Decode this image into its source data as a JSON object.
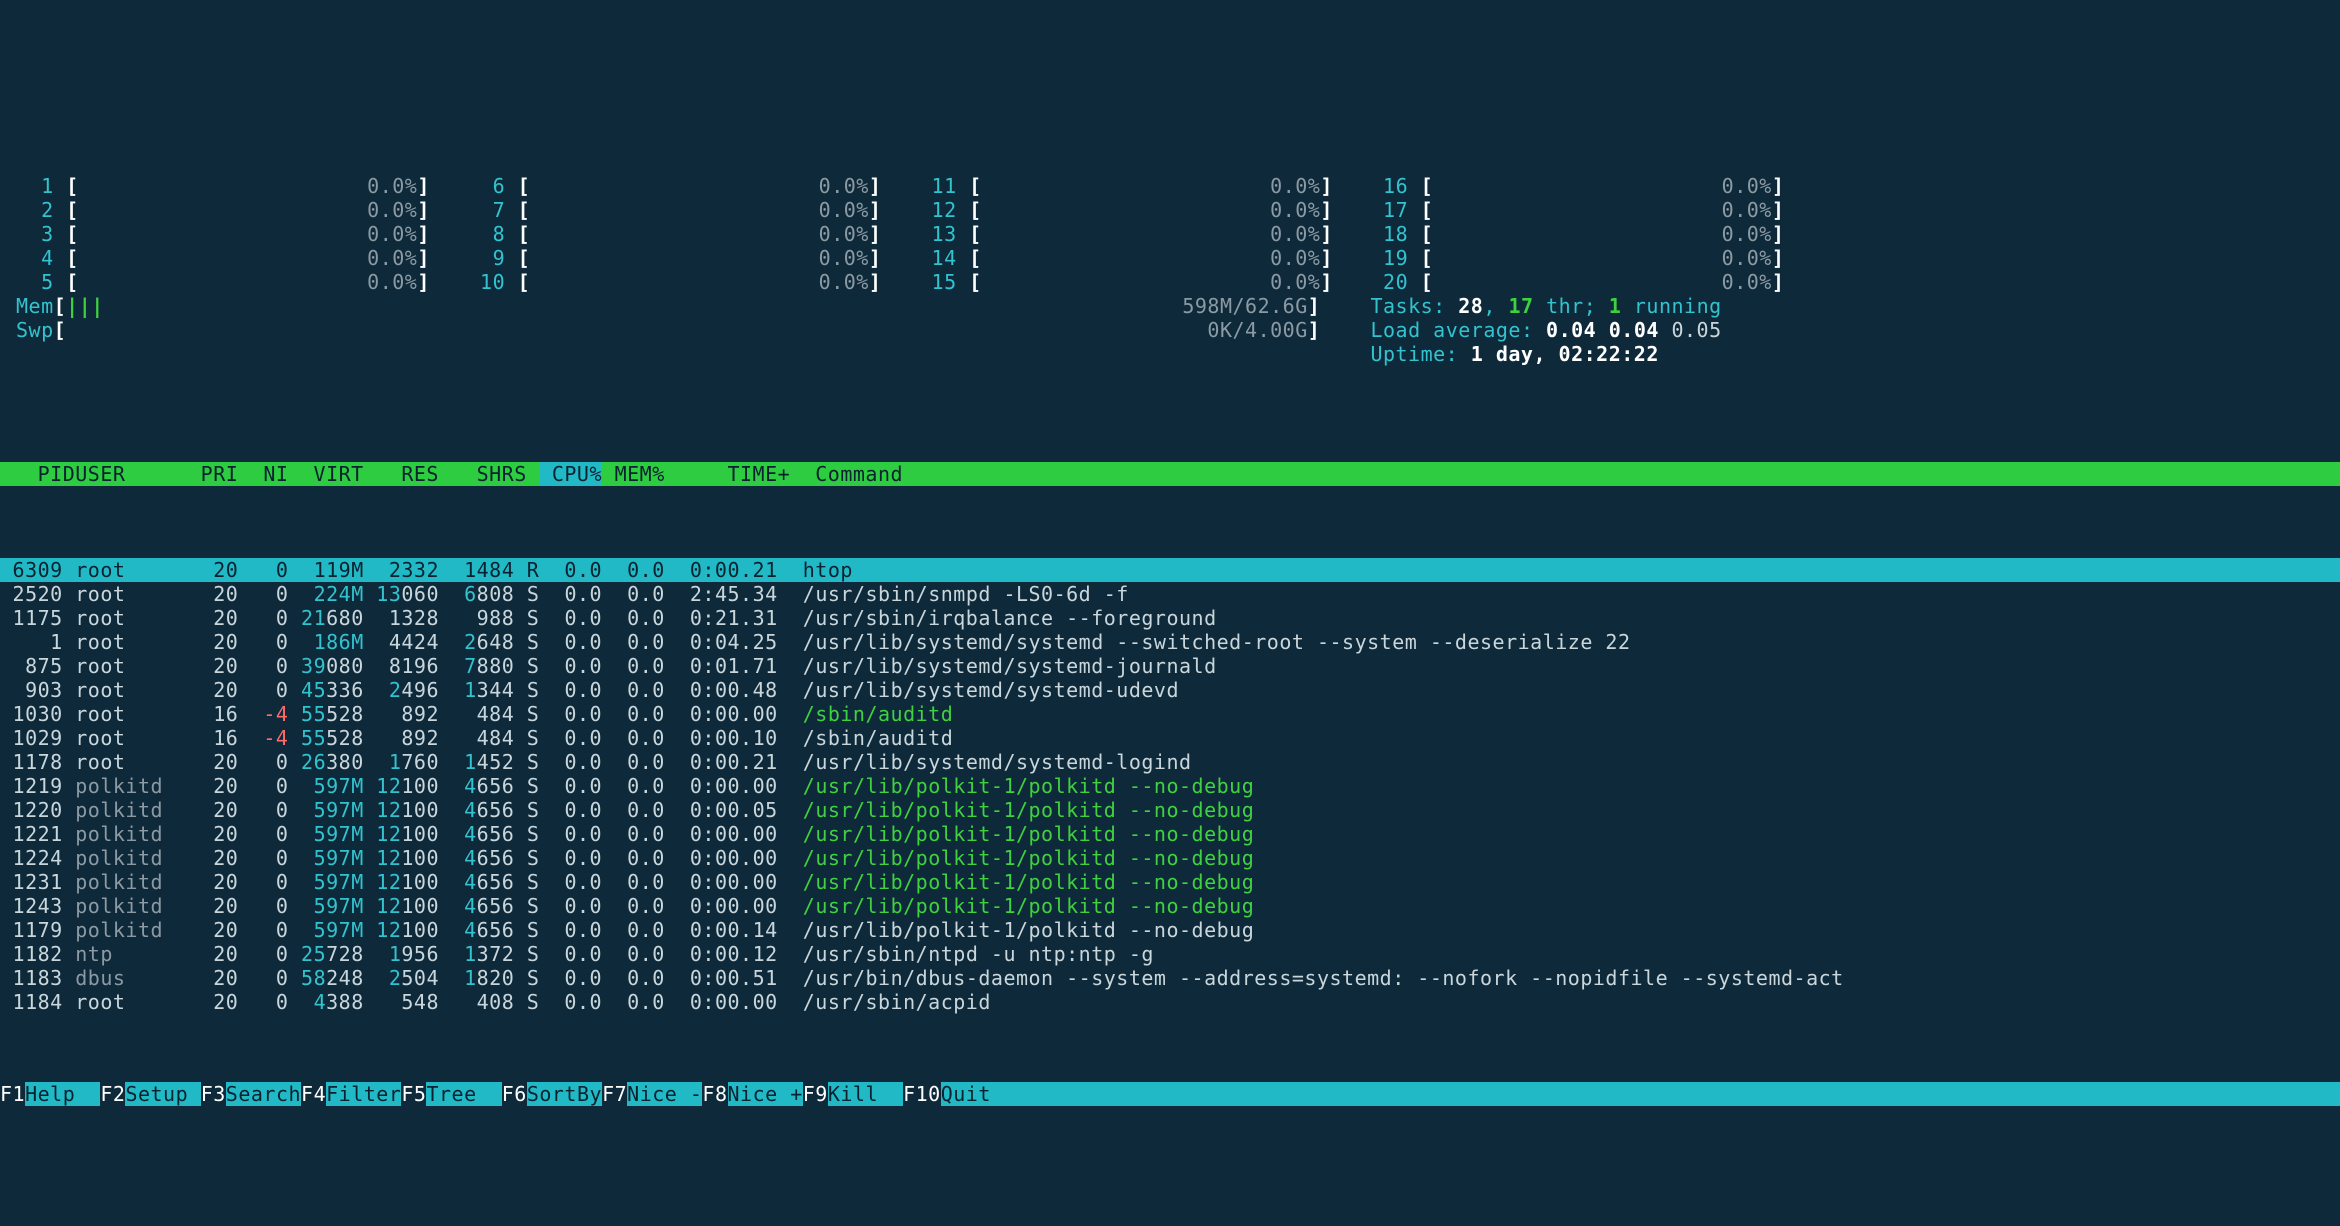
{
  "meters": {
    "cpus": [
      {
        "n": "1",
        "pct": "0.0%"
      },
      {
        "n": "2",
        "pct": "0.0%"
      },
      {
        "n": "3",
        "pct": "0.0%"
      },
      {
        "n": "4",
        "pct": "0.0%"
      },
      {
        "n": "5",
        "pct": "0.0%"
      },
      {
        "n": "6",
        "pct": "0.0%"
      },
      {
        "n": "7",
        "pct": "0.0%"
      },
      {
        "n": "8",
        "pct": "0.0%"
      },
      {
        "n": "9",
        "pct": "0.0%"
      },
      {
        "n": "10",
        "pct": "0.0%"
      },
      {
        "n": "11",
        "pct": "0.0%"
      },
      {
        "n": "12",
        "pct": "0.0%"
      },
      {
        "n": "13",
        "pct": "0.0%"
      },
      {
        "n": "14",
        "pct": "0.0%"
      },
      {
        "n": "15",
        "pct": "0.0%"
      },
      {
        "n": "16",
        "pct": "0.0%"
      },
      {
        "n": "17",
        "pct": "0.0%"
      },
      {
        "n": "18",
        "pct": "0.0%"
      },
      {
        "n": "19",
        "pct": "0.0%"
      },
      {
        "n": "20",
        "pct": "0.0%"
      }
    ],
    "mem": {
      "label": "Mem",
      "bars": "|||",
      "value": "598M/62.6G"
    },
    "swp": {
      "label": "Swp",
      "bars": "",
      "value": "0K/4.00G"
    },
    "tasks": {
      "label": "Tasks: ",
      "total": "28",
      "thr_sep": ", ",
      "thr": "17",
      "thr_word": " thr; ",
      "run": "1",
      "run_word": " running"
    },
    "load": {
      "label": "Load average: ",
      "v1": "0.04",
      "v2": "0.04",
      "v3": "0.05"
    },
    "uptime": {
      "label": "Uptime: ",
      "value": "1 day, 02:22:22"
    }
  },
  "columns": [
    "PID",
    "USER",
    "PRI",
    "NI",
    "VIRT",
    "RES",
    "SHR",
    "S",
    "CPU%",
    "MEM%",
    "TIME+",
    "Command"
  ],
  "sort_col": "CPU%",
  "rows": [
    {
      "sel": true,
      "pid": "6309",
      "user": "root",
      "pri": "20",
      "ni": "0",
      "virt": "119M",
      "res": "2332",
      "shr": "1484",
      "s": "R",
      "cpu": "0.0",
      "mem": "0.0",
      "time": "0:00.21",
      "cmd": "htop"
    },
    {
      "pid": "2520",
      "user": "root",
      "pri": "20",
      "ni": "0",
      "virt_c": "224M",
      "res_c": "13",
      "res": "060",
      "shr_c": "6",
      "shr": "808",
      "s": "S",
      "cpu": "0.0",
      "mem": "0.0",
      "time": "2:45.34",
      "cmd": "/usr/sbin/snmpd -LS0-6d -f"
    },
    {
      "pid": "1175",
      "user": "root",
      "pri": "20",
      "ni": "0",
      "virt_c": "21",
      "virt": "680",
      "res": "1328",
      "shr": "988",
      "s": "S",
      "cpu": "0.0",
      "mem": "0.0",
      "time": "0:21.31",
      "cmd": "/usr/sbin/irqbalance --foreground"
    },
    {
      "pid": "1",
      "user": "root",
      "pri": "20",
      "ni": "0",
      "virt_c": "186M",
      "res": "4424",
      "shr_c": "2",
      "shr": "648",
      "s": "S",
      "cpu": "0.0",
      "mem": "0.0",
      "time": "0:04.25",
      "cmd": "/usr/lib/systemd/systemd --switched-root --system --deserialize 22"
    },
    {
      "pid": "875",
      "user": "root",
      "pri": "20",
      "ni": "0",
      "virt_c": "39",
      "virt": "080",
      "res": "8196",
      "shr_c": "7",
      "shr": "880",
      "s": "S",
      "cpu": "0.0",
      "mem": "0.0",
      "time": "0:01.71",
      "cmd": "/usr/lib/systemd/systemd-journald"
    },
    {
      "pid": "903",
      "user": "root",
      "pri": "20",
      "ni": "0",
      "virt_c": "45",
      "virt": "336",
      "res_c": "2",
      "res": "496",
      "shr_c": "1",
      "shr": "344",
      "s": "S",
      "cpu": "0.0",
      "mem": "0.0",
      "time": "0:00.48",
      "cmd": "/usr/lib/systemd/systemd-udevd"
    },
    {
      "pid": "1030",
      "user": "root",
      "pri": "16",
      "ni": "-4",
      "ni_red": true,
      "virt_c": "55",
      "virt": "528",
      "res": "892",
      "shr": "484",
      "s": "S",
      "cpu": "0.0",
      "mem": "0.0",
      "time": "0:00.00",
      "cmd": "/sbin/auditd",
      "green": true
    },
    {
      "pid": "1029",
      "user": "root",
      "pri": "16",
      "ni": "-4",
      "ni_red": true,
      "virt_c": "55",
      "virt": "528",
      "res": "892",
      "shr": "484",
      "s": "S",
      "cpu": "0.0",
      "mem": "0.0",
      "time": "0:00.10",
      "cmd": "/sbin/auditd"
    },
    {
      "pid": "1178",
      "user": "root",
      "pri": "20",
      "ni": "0",
      "virt_c": "26",
      "virt": "380",
      "res_c": "1",
      "res": "760",
      "shr_c": "1",
      "shr": "452",
      "s": "S",
      "cpu": "0.0",
      "mem": "0.0",
      "time": "0:00.21",
      "cmd": "/usr/lib/systemd/systemd-logind"
    },
    {
      "pid": "1219",
      "user": "polkitd",
      "grey": true,
      "pri": "20",
      "ni": "0",
      "virt_c": "597M",
      "res_c": "12",
      "res": "100",
      "shr_c": "4",
      "shr": "656",
      "s": "S",
      "cpu": "0.0",
      "mem": "0.0",
      "time": "0:00.00",
      "cmd": "/usr/lib/polkit-1/polkitd --no-debug",
      "green": true
    },
    {
      "pid": "1220",
      "user": "polkitd",
      "grey": true,
      "pri": "20",
      "ni": "0",
      "virt_c": "597M",
      "res_c": "12",
      "res": "100",
      "shr_c": "4",
      "shr": "656",
      "s": "S",
      "cpu": "0.0",
      "mem": "0.0",
      "time": "0:00.05",
      "cmd": "/usr/lib/polkit-1/polkitd --no-debug",
      "green": true
    },
    {
      "pid": "1221",
      "user": "polkitd",
      "grey": true,
      "pri": "20",
      "ni": "0",
      "virt_c": "597M",
      "res_c": "12",
      "res": "100",
      "shr_c": "4",
      "shr": "656",
      "s": "S",
      "cpu": "0.0",
      "mem": "0.0",
      "time": "0:00.00",
      "cmd": "/usr/lib/polkit-1/polkitd --no-debug",
      "green": true
    },
    {
      "pid": "1224",
      "user": "polkitd",
      "grey": true,
      "pri": "20",
      "ni": "0",
      "virt_c": "597M",
      "res_c": "12",
      "res": "100",
      "shr_c": "4",
      "shr": "656",
      "s": "S",
      "cpu": "0.0",
      "mem": "0.0",
      "time": "0:00.00",
      "cmd": "/usr/lib/polkit-1/polkitd --no-debug",
      "green": true
    },
    {
      "pid": "1231",
      "user": "polkitd",
      "grey": true,
      "pri": "20",
      "ni": "0",
      "virt_c": "597M",
      "res_c": "12",
      "res": "100",
      "shr_c": "4",
      "shr": "656",
      "s": "S",
      "cpu": "0.0",
      "mem": "0.0",
      "time": "0:00.00",
      "cmd": "/usr/lib/polkit-1/polkitd --no-debug",
      "green": true
    },
    {
      "pid": "1243",
      "user": "polkitd",
      "grey": true,
      "pri": "20",
      "ni": "0",
      "virt_c": "597M",
      "res_c": "12",
      "res": "100",
      "shr_c": "4",
      "shr": "656",
      "s": "S",
      "cpu": "0.0",
      "mem": "0.0",
      "time": "0:00.00",
      "cmd": "/usr/lib/polkit-1/polkitd --no-debug",
      "green": true
    },
    {
      "pid": "1179",
      "user": "polkitd",
      "grey": true,
      "pri": "20",
      "ni": "0",
      "virt_c": "597M",
      "res_c": "12",
      "res": "100",
      "shr_c": "4",
      "shr": "656",
      "s": "S",
      "cpu": "0.0",
      "mem": "0.0",
      "time": "0:00.14",
      "cmd": "/usr/lib/polkit-1/polkitd --no-debug"
    },
    {
      "pid": "1182",
      "user": "ntp",
      "grey": true,
      "pri": "20",
      "ni": "0",
      "virt_c": "25",
      "virt": "728",
      "res_c": "1",
      "res": "956",
      "shr_c": "1",
      "shr": "372",
      "s": "S",
      "cpu": "0.0",
      "mem": "0.0",
      "time": "0:00.12",
      "cmd": "/usr/sbin/ntpd -u ntp:ntp -g"
    },
    {
      "pid": "1183",
      "user": "dbus",
      "grey": true,
      "pri": "20",
      "ni": "0",
      "virt_c": "58",
      "virt": "248",
      "res_c": "2",
      "res": "504",
      "shr_c": "1",
      "shr": "820",
      "s": "S",
      "cpu": "0.0",
      "mem": "0.0",
      "time": "0:00.51",
      "cmd": "/usr/bin/dbus-daemon --system --address=systemd: --nofork --nopidfile --systemd-act"
    },
    {
      "pid": "1184",
      "user": "root",
      "pri": "20",
      "ni": "0",
      "virt_c": "4",
      "virt": "388",
      "res": "548",
      "shr": "408",
      "s": "S",
      "cpu": "0.0",
      "mem": "0.0",
      "time": "0:00.00",
      "cmd": "/usr/sbin/acpid"
    }
  ],
  "fkeys": [
    {
      "k": "F1",
      "l": "Help  "
    },
    {
      "k": "F2",
      "l": "Setup "
    },
    {
      "k": "F3",
      "l": "Search"
    },
    {
      "k": "F4",
      "l": "Filter"
    },
    {
      "k": "F5",
      "l": "Tree  "
    },
    {
      "k": "F6",
      "l": "SortBy"
    },
    {
      "k": "F7",
      "l": "Nice -"
    },
    {
      "k": "F8",
      "l": "Nice +"
    },
    {
      "k": "F9",
      "l": "Kill  "
    },
    {
      "k": "F10",
      "l": "Quit  "
    }
  ]
}
